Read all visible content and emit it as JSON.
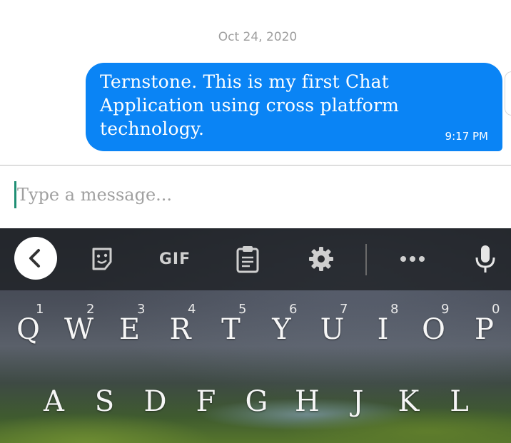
{
  "chat": {
    "date": "Oct 24, 2020",
    "message": {
      "text": "Ternstone. This is my first Chat Application using cross platform technology.",
      "time": "9:17 PM",
      "bubble_color": "#0a84f5"
    }
  },
  "composer": {
    "placeholder": "Type a message..."
  },
  "keyboard": {
    "toolbar": {
      "back_icon": "chevron-left-icon",
      "sticker_icon": "sticker-icon",
      "gif_label": "GIF",
      "clipboard_icon": "clipboard-icon",
      "settings_icon": "gear-icon",
      "more_icon": "more-icon",
      "mic_icon": "microphone-icon"
    },
    "row1": [
      {
        "key": "Q",
        "num": "1"
      },
      {
        "key": "W",
        "num": "2"
      },
      {
        "key": "E",
        "num": "3"
      },
      {
        "key": "R",
        "num": "4"
      },
      {
        "key": "T",
        "num": "5"
      },
      {
        "key": "Y",
        "num": "6"
      },
      {
        "key": "U",
        "num": "7"
      },
      {
        "key": "I",
        "num": "8"
      },
      {
        "key": "O",
        "num": "9"
      },
      {
        "key": "P",
        "num": "0"
      }
    ],
    "row2": [
      {
        "key": "A"
      },
      {
        "key": "S"
      },
      {
        "key": "D"
      },
      {
        "key": "F"
      },
      {
        "key": "G"
      },
      {
        "key": "H"
      },
      {
        "key": "J"
      },
      {
        "key": "K"
      },
      {
        "key": "L"
      }
    ]
  }
}
